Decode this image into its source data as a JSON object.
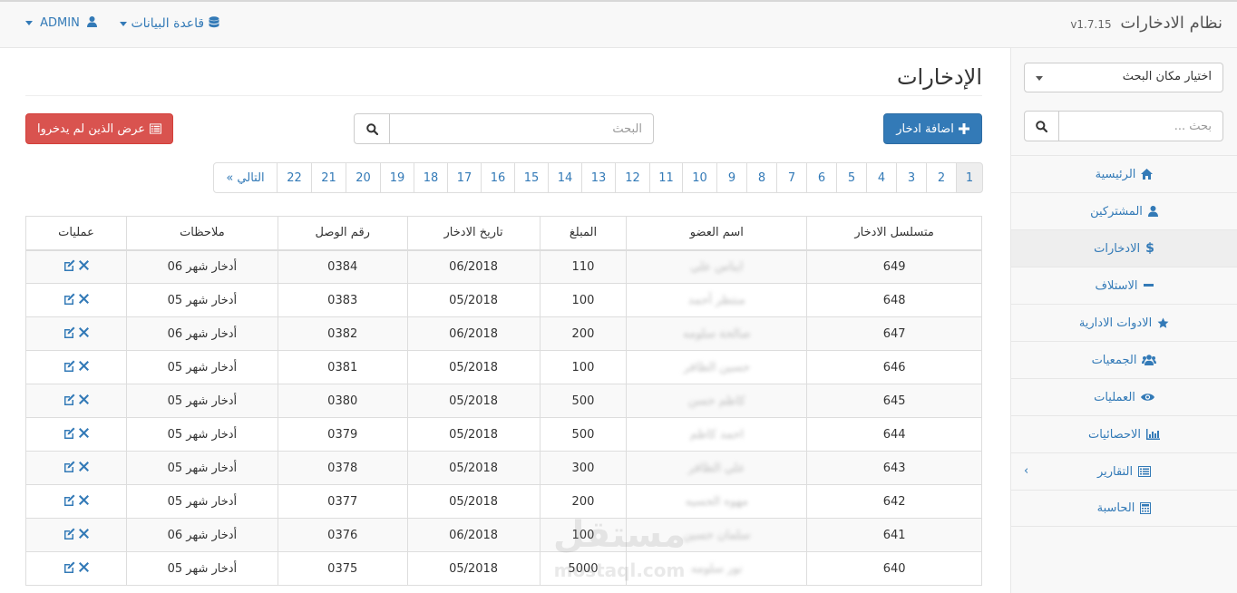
{
  "header": {
    "brand": "نظام الادخارات",
    "version": "v1.7.15",
    "db_menu": "قاعدة البيانات",
    "admin_menu": "ADMIN"
  },
  "sidebar": {
    "select_label": "اختيار مكان البحث",
    "search_placeholder": "بحث ...",
    "items": [
      {
        "label": "الرئيسية",
        "icon": "home-icon"
      },
      {
        "label": "المشتركين",
        "icon": "user-icon"
      },
      {
        "label": "الادخارات",
        "icon": "dollar-icon"
      },
      {
        "label": "الاستلاف",
        "icon": "minus-icon"
      },
      {
        "label": "الادوات الادارية",
        "icon": "star-icon"
      },
      {
        "label": "الجمعيات",
        "icon": "users-icon"
      },
      {
        "label": "العمليات",
        "icon": "eye-icon"
      },
      {
        "label": "الاحصائيات",
        "icon": "bar-chart-icon"
      },
      {
        "label": "التقارير",
        "icon": "list-alt-icon"
      },
      {
        "label": "الحاسبة",
        "icon": "calculator-icon"
      }
    ]
  },
  "main": {
    "title": "الإدخارات",
    "add_button": "اضافة ادخار",
    "non_savers_button": "عرض الذين لم يدخروا",
    "search_placeholder": "البحث",
    "pagination": [
      "1",
      "2",
      "3",
      "4",
      "5",
      "6",
      "7",
      "8",
      "9",
      "10",
      "11",
      "12",
      "13",
      "14",
      "15",
      "16",
      "17",
      "18",
      "19",
      "20",
      "21",
      "22"
    ],
    "next_label": "التالي »",
    "columns": [
      "متسلسل الادخار",
      "اسم العضو",
      "المبلغ",
      "تاريخ الادخار",
      "رقم الوصل",
      "ملاحظات",
      "عمليات"
    ],
    "rows": [
      {
        "id": "649",
        "name": "ايناس علي",
        "amount": "110",
        "date": "06/2018",
        "receipt": "0384",
        "note": "أدخار شهر 06"
      },
      {
        "id": "648",
        "name": "منتظر أحمد",
        "amount": "100",
        "date": "05/2018",
        "receipt": "0383",
        "note": "أدخار شهر 05"
      },
      {
        "id": "647",
        "name": "صالحة سلومه",
        "amount": "200",
        "date": "06/2018",
        "receipt": "0382",
        "note": "أدخار شهر 06"
      },
      {
        "id": "646",
        "name": "حسين الظافر",
        "amount": "100",
        "date": "05/2018",
        "receipt": "0381",
        "note": "أدخار شهر 05"
      },
      {
        "id": "645",
        "name": "كاظم حسن",
        "amount": "500",
        "date": "05/2018",
        "receipt": "0380",
        "note": "أدخار شهر 05"
      },
      {
        "id": "644",
        "name": "احمد كاظم",
        "amount": "500",
        "date": "05/2018",
        "receipt": "0379",
        "note": "أدخار شهر 05"
      },
      {
        "id": "643",
        "name": "علي الظافر",
        "amount": "300",
        "date": "05/2018",
        "receipt": "0378",
        "note": "أدخار شهر 05"
      },
      {
        "id": "642",
        "name": "مهوه الحسيه",
        "amount": "200",
        "date": "05/2018",
        "receipt": "0377",
        "note": "أدخار شهر 05"
      },
      {
        "id": "641",
        "name": "سلمان حسين",
        "amount": "100",
        "date": "06/2018",
        "receipt": "0376",
        "note": "أدخار شهر 06"
      },
      {
        "id": "640",
        "name": "نور سلومه",
        "amount": "5000",
        "date": "05/2018",
        "receipt": "0375",
        "note": "أدخار شهر 05"
      }
    ]
  },
  "watermark": {
    "text": "مستقل",
    "sub": "mostaql.com"
  },
  "colors": {
    "primary": "#337ab7",
    "danger": "#d9534f"
  }
}
